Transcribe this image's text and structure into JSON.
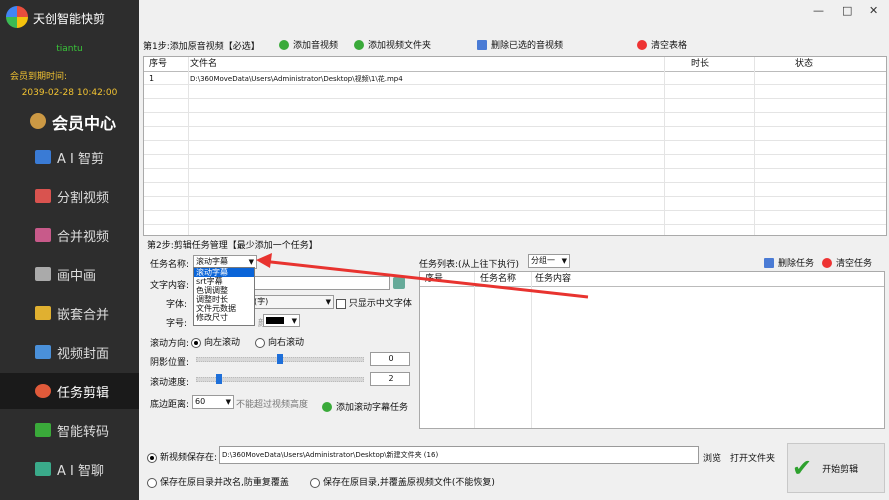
{
  "app": {
    "title": "天创智能快剪"
  },
  "user": {
    "name": "tiantu",
    "expiry_label": "会员到期时间:",
    "expiry_date": "2039-02-28 10:42:00"
  },
  "sidebar": {
    "vip_label": "会员中心",
    "items": [
      {
        "label": "A I 智剪",
        "icon": "ai-edit-icon",
        "color": "#3a7bd5"
      },
      {
        "label": "分割视频",
        "icon": "split-video-icon",
        "color": "#d9534f"
      },
      {
        "label": "合并视频",
        "icon": "merge-video-icon",
        "color": "#c85a8a"
      },
      {
        "label": "画中画",
        "icon": "picture-in-picture-icon",
        "color": "#aaaaaa"
      },
      {
        "label": "嵌套合并",
        "icon": "nest-merge-icon",
        "color": "#e0b030"
      },
      {
        "label": "视频封面",
        "icon": "video-cover-icon",
        "color": "#4a90d9"
      },
      {
        "label": "任务剪辑",
        "icon": "task-edit-icon",
        "color": "#e05a3a"
      },
      {
        "label": "智能转码",
        "icon": "transcode-icon",
        "color": "#3aaa3a"
      },
      {
        "label": "A I 智聊",
        "icon": "ai-chat-icon",
        "color": "#3aaa8a"
      }
    ],
    "active_index": 6
  },
  "window": {
    "minimize": "—",
    "maximize": "□",
    "close": "✕"
  },
  "step1": {
    "label": "第1步:添加原音视频【必选】",
    "buttons": {
      "add_video": "添加音视频",
      "add_folder": "添加视频文件夹",
      "delete_selected": "删除已选的音视频",
      "clear_table": "清空表格"
    },
    "columns": [
      "序号",
      "文件名",
      "时长",
      "状态"
    ],
    "rows": [
      {
        "index": "1",
        "file": "D:\\360MoveData\\Users\\Administrator\\Desktop\\视频\\1\\花.mp4",
        "duration": "",
        "status": ""
      }
    ]
  },
  "step2": {
    "label": "第2步:剪辑任务管理【最少添加一个任务】",
    "task_name_label": "任务名称:",
    "task_name_value": "滚动字幕",
    "task_options": [
      "滚动字幕",
      "srt字幕",
      "色调调整",
      "调整时长",
      "文件元数据",
      "修改尺寸"
    ],
    "text_content_label": "文字内容:",
    "font_label": "字体:",
    "font_value": "(字)",
    "chinese_font_only": "只显示中文字体",
    "size_label": "字号:",
    "color_label": "颜色:",
    "direction_label": "滚动方向:",
    "direction_left": "向左滚动",
    "direction_right": "向右滚动",
    "shadow_label": "阴影位置:",
    "shadow_value": "0",
    "speed_label": "滚动速度:",
    "speed_value": "2",
    "shadow_slider_level": 0.5,
    "speed_slider_level": 0.13,
    "bottom_distance_label": "底边距离:",
    "bottom_distance_value": "60",
    "bottom_distance_hint": "不能超过视频高度",
    "add_task_button": "添加滚动字幕任务",
    "task_list_label": "任务列表:(从上往下执行)",
    "group_value": "分组一",
    "delete_task": "删除任务",
    "clear_tasks": "清空任务",
    "task_columns": [
      "序号",
      "任务名称",
      "任务内容"
    ]
  },
  "output": {
    "save_new_label": "新视频保存在:",
    "save_path": "D:\\360MoveData\\Users\\Administrator\\Desktop\\新建文件夹 (16)",
    "browse": "浏览",
    "open_folder": "打开文件夹",
    "save_original_rename": "保存在原目录并改名,防重复覆盖",
    "save_original_overwrite": "保存在原目录,并覆盖原视频文件(不能恢复)",
    "start_button": "开始剪辑"
  },
  "colors": {
    "sidebar_bg": "#2d2d2d",
    "selection": "#0a64d8",
    "annotation_arrow": "#e8332f",
    "start_check": "#2ea12e"
  }
}
